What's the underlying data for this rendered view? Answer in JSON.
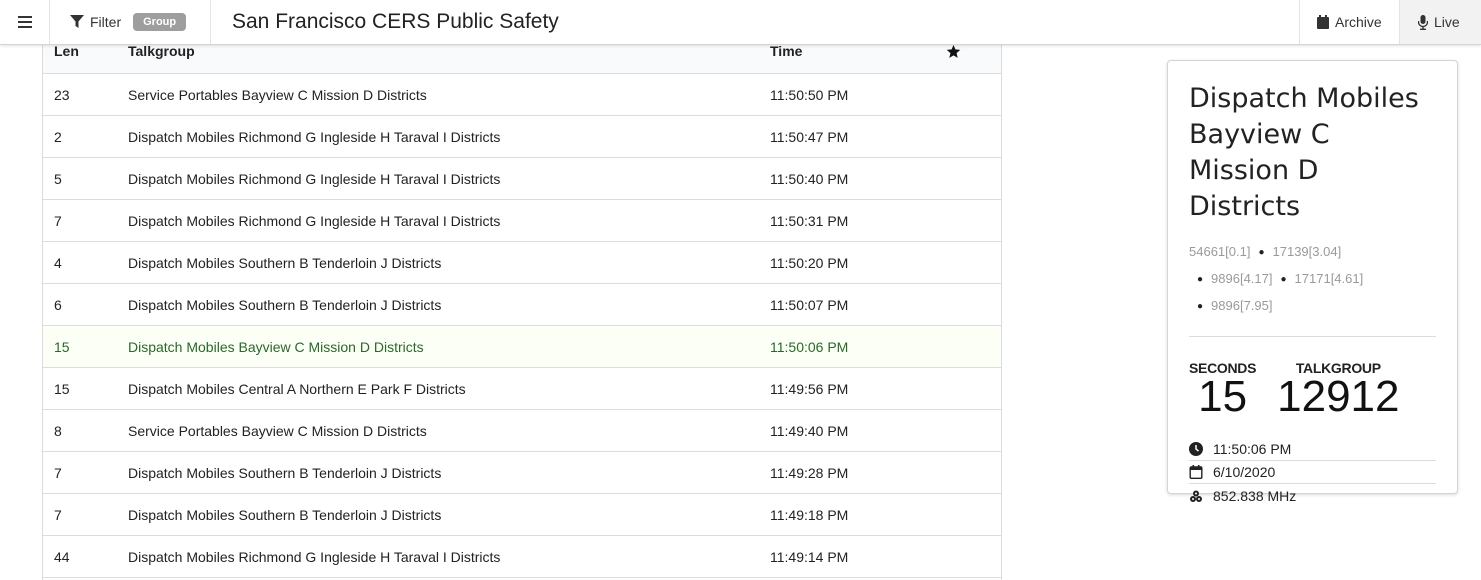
{
  "header": {
    "filter_label": "Filter",
    "group_badge": "Group",
    "title": "San Francisco CERS Public Safety",
    "archive_label": "Archive",
    "live_label": "Live"
  },
  "table": {
    "columns": {
      "len": "Len",
      "talkgroup": "Talkgroup",
      "time": "Time"
    },
    "rows": [
      {
        "len": "23",
        "talkgroup": "Service Portables Bayview C Mission D Districts",
        "time": "11:50:50 PM"
      },
      {
        "len": "2",
        "talkgroup": "Dispatch Mobiles Richmond G Ingleside H Taraval I Districts",
        "time": "11:50:47 PM"
      },
      {
        "len": "5",
        "talkgroup": "Dispatch Mobiles Richmond G Ingleside H Taraval I Districts",
        "time": "11:50:40 PM"
      },
      {
        "len": "7",
        "talkgroup": "Dispatch Mobiles Richmond G Ingleside H Taraval I Districts",
        "time": "11:50:31 PM"
      },
      {
        "len": "4",
        "talkgroup": "Dispatch Mobiles Southern B Tenderloin J Districts",
        "time": "11:50:20 PM"
      },
      {
        "len": "6",
        "talkgroup": "Dispatch Mobiles Southern B Tenderloin J Districts",
        "time": "11:50:07 PM"
      },
      {
        "len": "15",
        "talkgroup": "Dispatch Mobiles Bayview C Mission D Districts",
        "time": "11:50:06 PM",
        "active": true
      },
      {
        "len": "15",
        "talkgroup": "Dispatch Mobiles Central A Northern E Park F Districts",
        "time": "11:49:56 PM"
      },
      {
        "len": "8",
        "talkgroup": "Service Portables Bayview C Mission D Districts",
        "time": "11:49:40 PM"
      },
      {
        "len": "7",
        "talkgroup": "Dispatch Mobiles Southern B Tenderloin J Districts",
        "time": "11:49:28 PM"
      },
      {
        "len": "7",
        "talkgroup": "Dispatch Mobiles Southern B Tenderloin J Districts",
        "time": "11:49:18 PM"
      },
      {
        "len": "44",
        "talkgroup": "Dispatch Mobiles Richmond G Ingleside H Taraval I Districts",
        "time": "11:49:14 PM"
      }
    ]
  },
  "card": {
    "title": "Dispatch Mobiles Bayview C Mission D Districts",
    "sources": [
      "54661[0.1]",
      "17139[3.04]",
      "9896[4.17]",
      "17171[4.61]",
      "9896[7.95]"
    ],
    "seconds_label": "SECONDS",
    "seconds_value": "15",
    "talkgroup_label": "TALKGROUP",
    "talkgroup_value": "12912",
    "time": "11:50:06 PM",
    "date": "6/10/2020",
    "frequency": "852.838 MHz"
  },
  "colors": {
    "active_row_bg": "#fcfff5",
    "active_row_text": "#2c662d",
    "badge_bg": "#9e9e9e"
  },
  "icons": {
    "menu": "hamburger-icon",
    "filter": "filter-icon",
    "archive": "calendar-icon",
    "live": "microphone-icon",
    "star": "star-icon",
    "time": "clock-icon",
    "date": "calendar-icon",
    "frequency": "antenna-icon"
  }
}
